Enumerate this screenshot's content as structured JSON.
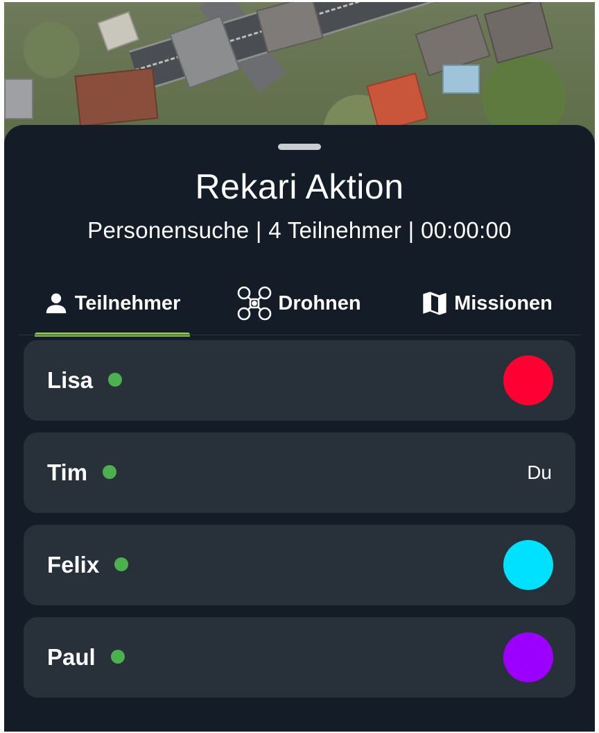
{
  "sheet": {
    "title": "Rekari Aktion",
    "subtitle": "Personensuche | 4 Teilnehmer | 00:00:00"
  },
  "tabs": [
    {
      "label": "Teilnehmer",
      "icon": "person-icon",
      "selected": true
    },
    {
      "label": "Drohnen",
      "icon": "drone-icon",
      "selected": false
    },
    {
      "label": "Missionen",
      "icon": "map-icon",
      "selected": false
    }
  ],
  "participants": [
    {
      "name": "Lisa",
      "status_color": "#4caf50",
      "color": "#ff0033",
      "label": ""
    },
    {
      "name": "Tim",
      "status_color": "#4caf50",
      "color": "",
      "label": "Du"
    },
    {
      "name": "Felix",
      "status_color": "#4caf50",
      "color": "#00e0ff",
      "label": ""
    },
    {
      "name": "Paul",
      "status_color": "#4caf50",
      "color": "#9b00ff",
      "label": ""
    }
  ],
  "colors": {
    "sheet_background": "#141c27",
    "card_background": "#283039",
    "tab_indicator": "#8bc34a"
  }
}
